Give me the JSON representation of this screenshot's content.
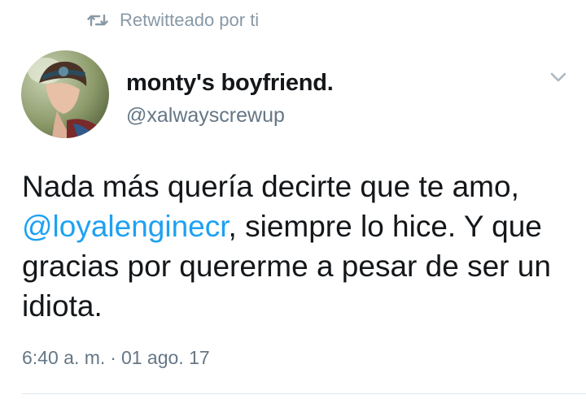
{
  "retweet": {
    "icon": "retweet-icon",
    "label": "Retwitteado por ti"
  },
  "author": {
    "display_name": "monty's boyfriend.",
    "handle": "@xalwayscrewup",
    "avatar_icon": "avatar-photo"
  },
  "menu": {
    "icon": "chevron-down-icon"
  },
  "tweet": {
    "text_before": "Nada más quería decirte que te amo, ",
    "mention": "@loyalenginecr",
    "text_after": ", siempre lo hice. Y que gracias por quererme a pesar de ser un idiota.",
    "time": "6:40 a. m.",
    "separator": "·",
    "date": "01 ago. 17"
  },
  "colors": {
    "mention": "#1da1f2",
    "secondary_text": "#657786",
    "retweet_gray": "#8899a6"
  }
}
